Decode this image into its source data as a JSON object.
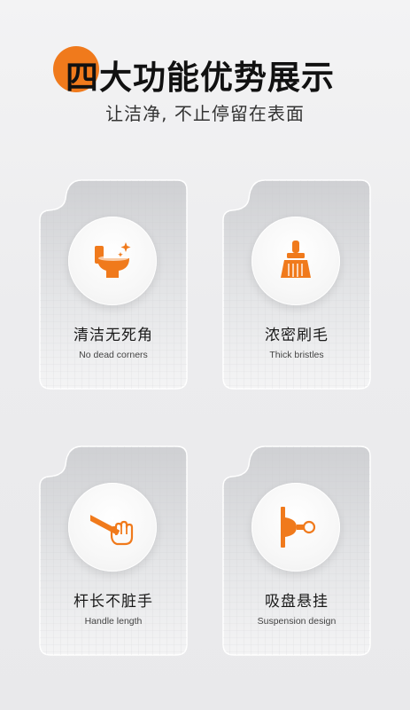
{
  "header": {
    "title": "四大功能优势展示",
    "subtitle": "让洁净, 不止停留在表面"
  },
  "features": [
    {
      "title": "清洁无死角",
      "subtitle": "No dead corners",
      "icon": "toilet-icon"
    },
    {
      "title": "浓密刷毛",
      "subtitle": "Thick bristles",
      "icon": "brush-icon"
    },
    {
      "title": "杆长不脏手",
      "subtitle": "Handle length",
      "icon": "hand-handle-icon"
    },
    {
      "title": "吸盘悬挂",
      "subtitle": "Suspension design",
      "icon": "suction-hook-icon"
    }
  ],
  "colors": {
    "accent": "#f07a1c",
    "card": "#d9dadc"
  }
}
